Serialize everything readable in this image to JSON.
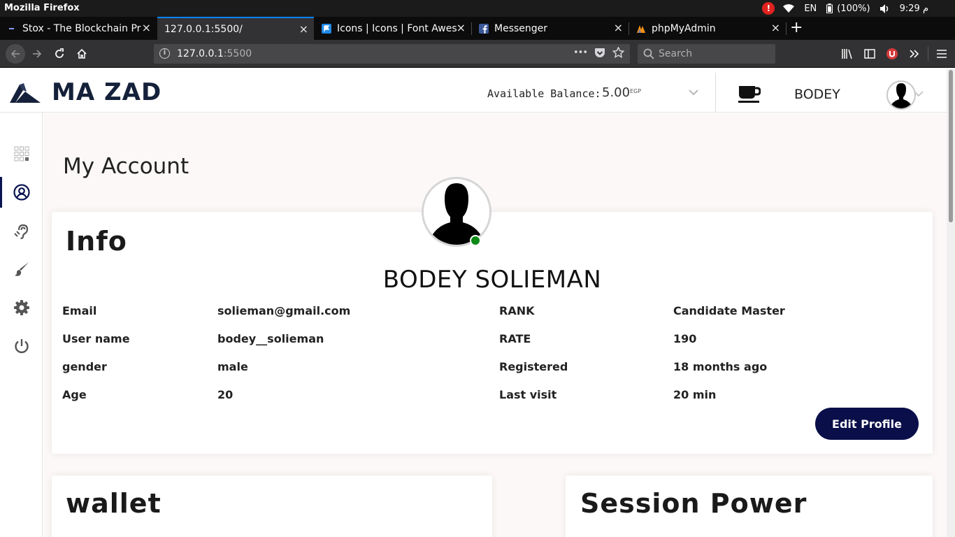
{
  "os": {
    "app_title": "Mozilla Firefox",
    "alert": "!",
    "lang": "EN",
    "battery": "(100%)",
    "clock": "9:29 م"
  },
  "tabs": [
    {
      "label": "Stox - The Blockchain Pr",
      "icon": "stox-favicon",
      "active": false
    },
    {
      "label": "127.0.0.1:5500/",
      "icon": "none",
      "active": true
    },
    {
      "label": "Icons | Icons | Font Awes",
      "icon": "font-awesome-favicon",
      "active": false
    },
    {
      "label": "Messenger",
      "icon": "facebook-favicon",
      "active": false
    },
    {
      "label": "phpMyAdmin",
      "icon": "phpmyadmin-favicon",
      "active": false
    }
  ],
  "tab_close": "×",
  "new_tab": "+",
  "nav": {
    "url_host": "127.0.0.1",
    "url_port": ":5500",
    "url_dots": "•••",
    "search_placeholder": "Search"
  },
  "header": {
    "brand": "MA ZAD",
    "balance_label": "Available Balance:",
    "balance_value": "5.00",
    "balance_unit": "EGP",
    "username": "BODEY"
  },
  "sidebar": {
    "items": [
      {
        "name": "dashboard",
        "icon": "grid-icon",
        "active": false
      },
      {
        "name": "account",
        "icon": "user-circle-icon",
        "active": true
      },
      {
        "name": "accessibility",
        "icon": "hearing-icon",
        "active": false
      },
      {
        "name": "theme",
        "icon": "paint-brush-icon",
        "active": false
      },
      {
        "name": "settings",
        "icon": "gear-icon",
        "active": false
      },
      {
        "name": "logout",
        "icon": "power-icon",
        "active": false
      }
    ]
  },
  "main": {
    "page_title": "My Account",
    "info": {
      "title": "Info",
      "full_name": "BODEY SOLIEMAN",
      "left_fields": [
        {
          "label": "Email",
          "value": "solieman@gmail.com"
        },
        {
          "label": "User name",
          "value": "bodey__solieman"
        },
        {
          "label": "gender",
          "value": "male"
        },
        {
          "label": "Age",
          "value": "20"
        }
      ],
      "right_fields": [
        {
          "label": "RANK",
          "value": "Candidate Master"
        },
        {
          "label": "RATE",
          "value": "190"
        },
        {
          "label": "Registered",
          "value": "18 months ago"
        },
        {
          "label": "Last visit",
          "value": "20 min"
        }
      ],
      "edit_button": "Edit Profile"
    },
    "wallet": {
      "title": "wallet"
    },
    "session": {
      "title": "Session Power"
    }
  },
  "colors": {
    "accent": "#0a0f4a",
    "brand": "#15213a",
    "online": "#0e8a16",
    "alert": "#e0221f",
    "tab_highlight": "#0a84ff"
  }
}
